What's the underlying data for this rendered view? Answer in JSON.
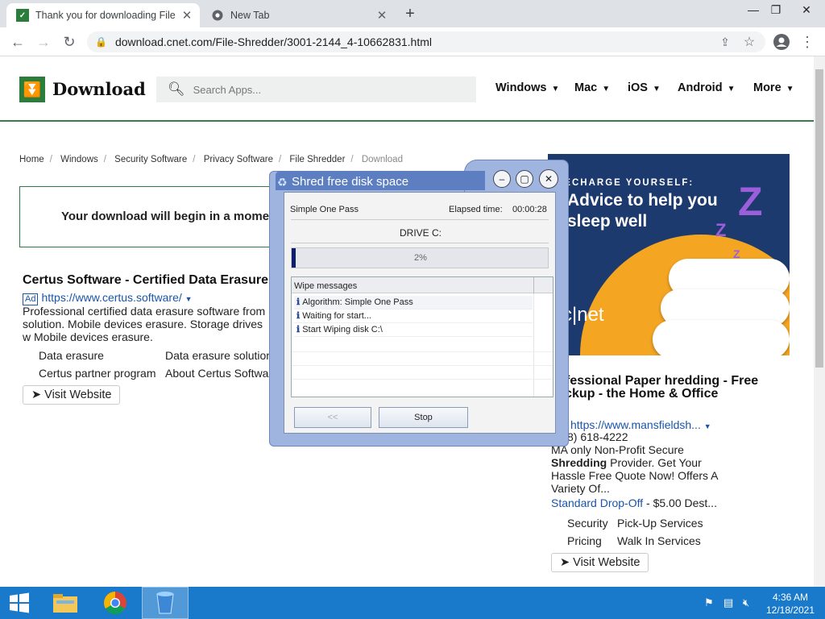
{
  "browser": {
    "tabs": [
      {
        "title": "Thank you for downloading File",
        "favicon": "cnet-download-favicon"
      },
      {
        "title": "New Tab",
        "favicon": "chrome-favicon"
      }
    ],
    "new_tab": "+",
    "url": "download.cnet.com/File-Shredder/3001-2144_4-10662831.html",
    "window_controls": {
      "minimize": "—",
      "restore": "❐",
      "close": "✕"
    }
  },
  "site": {
    "logo_text": "Download",
    "search_placeholder": "Search Apps...",
    "nav": [
      "Windows",
      "Mac",
      "iOS",
      "Android",
      "More"
    ],
    "breadcrumbs": [
      "Home",
      "Windows",
      "Security Software",
      "Privacy Software",
      "File Shredder",
      "Download"
    ],
    "download_message": "Your download will begin in a mome"
  },
  "left_ad": {
    "title": "Certus Software - Certified Data Erasure",
    "badge": "Ad",
    "url": "https://www.certus.software/",
    "description": "Professional certified data erasure software from solution. Mobile devices erasure. Storage drives w Mobile devices erasure.",
    "sublinks": [
      [
        "Data erasure",
        "Data erasure solution"
      ],
      [
        "Certus partner program",
        "About Certus Softwa"
      ]
    ],
    "visit_label": "➤ Visit Website"
  },
  "banner": {
    "kicker": "RECHARGE YOURSELF:",
    "headline": "Advice to help you sleep well",
    "brand": "c|net"
  },
  "right_ad": {
    "title": "rofessional Paper hredding - Free Pickup - the Home & Office",
    "url": "https://www.mansfieldsh...",
    "phone": "8) 618-4222",
    "desc1": "MA only Non-Profit Secure",
    "desc2_bold": "Shredding",
    "desc2": " Provider. Get Your",
    "desc3": "Hassle Free Quote Now! Offers A",
    "desc4": "Variety Of...",
    "offer_link": "Standard Drop-Off",
    "offer_rest": " - $5.00  Dest...",
    "sublinks": [
      [
        "Security",
        "Pick-Up Services"
      ],
      [
        "Pricing",
        "Walk In Services"
      ]
    ],
    "visit_label": "➤ Visit Website"
  },
  "dialog": {
    "title": "Shred free disk space",
    "algorithm_label": "Simple One Pass",
    "elapsed_label": "Elapsed time:",
    "elapsed_value": "00:00:28",
    "drive": "DRIVE C:",
    "progress_text": "2%",
    "progress_fraction": 0.02,
    "list_header": "Wipe messages",
    "messages": [
      "Algorithm: Simple One Pass",
      "Waiting for start...",
      "Start Wiping disk C:\\"
    ],
    "back_label": "<<",
    "stop_label": "Stop"
  },
  "taskbar": {
    "time": "4:36 AM",
    "date": "12/18/2021"
  },
  "colors": {
    "brand_green": "#2a7d3a",
    "link_blue": "#1a55a8",
    "taskbar": "#1979ca"
  }
}
